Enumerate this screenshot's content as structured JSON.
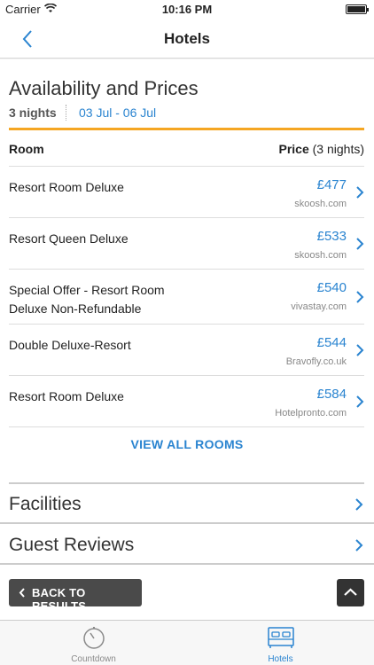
{
  "status_bar": {
    "carrier": "Carrier",
    "time": "10:16 PM"
  },
  "nav": {
    "title": "Hotels"
  },
  "availability": {
    "title": "Availability and Prices",
    "nights": "3 nights",
    "dates": "03 Jul - 06 Jul",
    "header_room": "Room",
    "header_price": "Price",
    "header_price_suffix": "(3 nights)",
    "rooms": [
      {
        "name": "Resort Room Deluxe",
        "price": "£477",
        "source": "skoosh.com"
      },
      {
        "name": "Resort Queen Deluxe",
        "price": "£533",
        "source": "skoosh.com"
      },
      {
        "name": "Special Offer - Resort Room Deluxe Non-Refundable",
        "price": "£540",
        "source": "vivastay.com"
      },
      {
        "name": "Double Deluxe-Resort",
        "price": "£544",
        "source": "Bravofly.co.uk"
      },
      {
        "name": "Resort Room Deluxe",
        "price": "£584",
        "source": "Hotelpronto.com"
      }
    ],
    "view_all": "VIEW ALL ROOMS"
  },
  "sections": {
    "facilities": "Facilities",
    "reviews": "Guest Reviews"
  },
  "footer": {
    "back_label": "BACK TO RESULTS"
  },
  "tabs": [
    {
      "label": "Countdown",
      "icon": "stopwatch-icon"
    },
    {
      "label": "Hotels",
      "icon": "bed-icon"
    }
  ],
  "colors": {
    "accent": "#2a84d0",
    "orange": "#f5a623",
    "dark_button": "#4a4a4a"
  }
}
